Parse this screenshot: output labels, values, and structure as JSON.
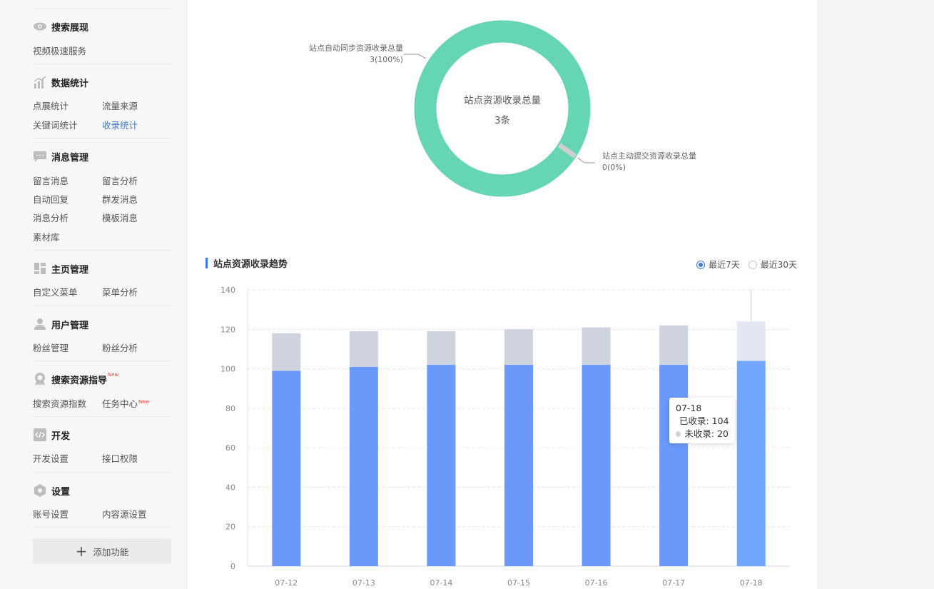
{
  "sidebar": {
    "sections": {
      "search_display": {
        "title": "搜索展现",
        "links": [
          "视频极速服务"
        ]
      },
      "data_stats": {
        "title": "数据统计",
        "links": [
          "点展统计",
          "流量来源",
          "关键词统计",
          "收录统计"
        ]
      },
      "messages": {
        "title": "消息管理",
        "links": [
          "留言消息",
          "留言分析",
          "自动回复",
          "群发消息",
          "消息分析",
          "模板消息",
          "素材库"
        ]
      },
      "homepage": {
        "title": "主页管理",
        "links": [
          "自定义菜单",
          "菜单分析"
        ]
      },
      "users": {
        "title": "用户管理",
        "links": [
          "粉丝管理",
          "粉丝分析"
        ]
      },
      "search_guide": {
        "title": "搜索资源指导",
        "badge": "New",
        "links": [
          "搜索资源指数",
          "任务中心"
        ],
        "link_badge": "New"
      },
      "dev": {
        "title": "开发",
        "links": [
          "开发设置",
          "接口权限"
        ]
      },
      "settings": {
        "title": "设置",
        "links": [
          "账号设置",
          "内容源设置"
        ]
      }
    },
    "active_link": "收录统计",
    "add_button": "添加功能"
  },
  "donut": {
    "center_title": "站点资源收录总量",
    "center_value": "3条",
    "label_left_name": "站点自动同步资源收录总量",
    "label_left_value": "3(100%)",
    "label_right_name": "站点主动提交资源收录总量",
    "label_right_value": "0(0%)",
    "colors": {
      "auto": "#66d5b4",
      "manual": "#cfcfcf"
    }
  },
  "trend": {
    "title": "站点资源收录趋势",
    "ranges": [
      "最近7天",
      "最近30天"
    ],
    "selected_range": "最近7天"
  },
  "tooltip": {
    "date": "07-18",
    "indexed_label": "已收录: 104",
    "not_indexed_label": "未收录: 20"
  },
  "chart_data": {
    "type": "bar",
    "stacked": true,
    "categories": [
      "07-12",
      "07-13",
      "07-14",
      "07-15",
      "07-16",
      "07-17",
      "07-18"
    ],
    "series": [
      {
        "name": "已收录",
        "values": [
          99,
          101,
          102,
          102,
          102,
          102,
          104
        ],
        "color": "#6b98fb"
      },
      {
        "name": "未收录",
        "values": [
          19,
          18,
          17,
          18,
          19,
          20,
          20
        ],
        "color": "#cfd3dd"
      }
    ],
    "ylim": [
      0,
      140
    ],
    "yticks": [
      0,
      20,
      40,
      60,
      80,
      100,
      120,
      140
    ],
    "grid": true,
    "highlight_category": "07-18",
    "highlight_colors": {
      "indexed": "#72a6fc",
      "not_indexed": "#e3e7f2"
    }
  }
}
